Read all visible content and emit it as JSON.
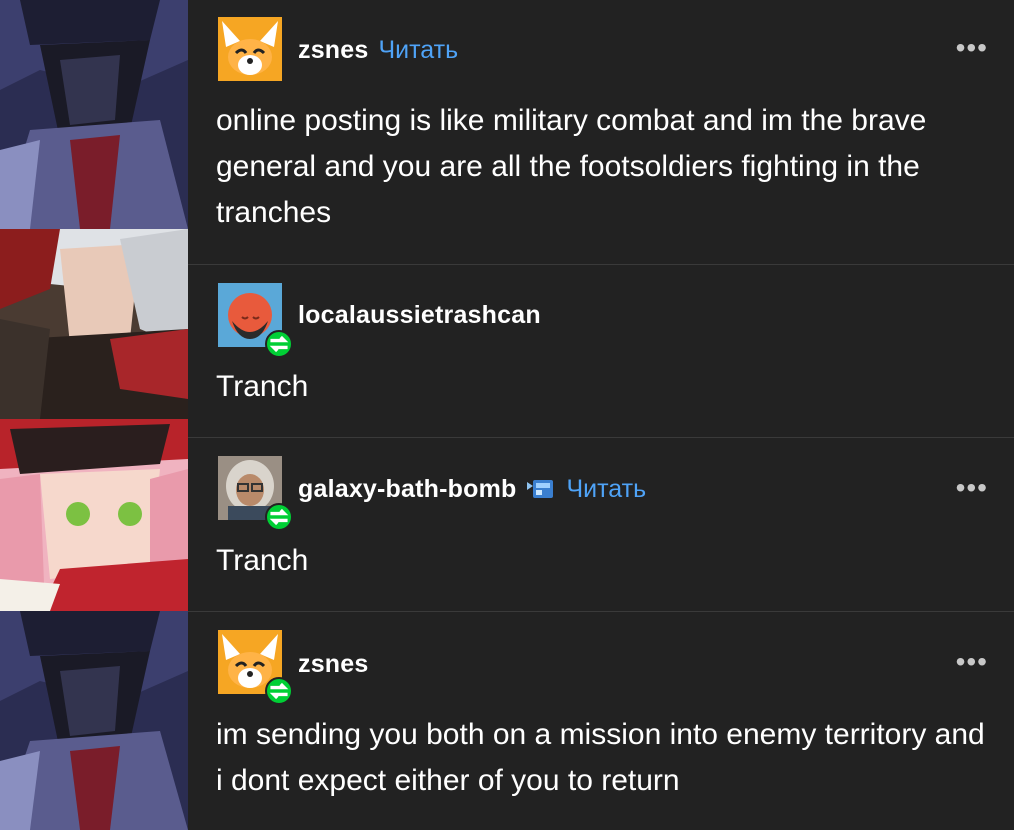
{
  "posts": [
    {
      "username": "zsnes",
      "follow_label": "Читать",
      "avatar_icon": "fox-avatar",
      "reblogged": false,
      "body": "online posting is like military combat and im the brave general and you are all the footsoldiers fighting in the tranches",
      "has_menu": true
    },
    {
      "username": "localaussietrashcan",
      "avatar_icon": "orange-face-avatar",
      "reblogged": true,
      "body": "Tranch",
      "has_menu": false
    },
    {
      "username": "galaxy-bath-bomb",
      "follow_label": "Читать",
      "avatar_icon": "person-photo-avatar",
      "badge_icon": "blue-sticker-icon",
      "reblogged": true,
      "body": "Tranch",
      "has_menu": true
    },
    {
      "username": "zsnes",
      "avatar_icon": "fox-avatar",
      "reblogged": true,
      "body": "im sending you both on a mission into enemy territory and i dont expect either of you to return",
      "has_menu": true
    }
  ],
  "menu_glyph": "•••",
  "colors": {
    "background": "#222222",
    "follow_link": "#4fa3f7",
    "reblog_badge": "#00cf35",
    "separator": "#3a3a3a"
  }
}
